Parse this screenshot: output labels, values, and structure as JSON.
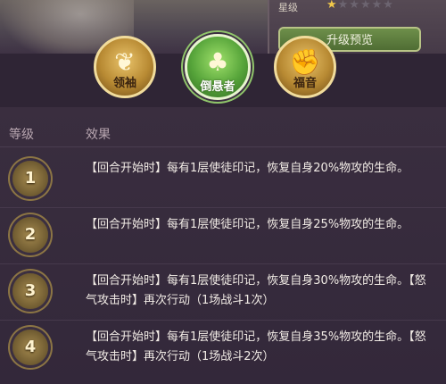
{
  "top": {
    "quality_label": "星级",
    "stars_on": "★",
    "stars_off": "★★★★★",
    "preview_label": "升级预览"
  },
  "tabs": [
    {
      "label": "领袖",
      "icon": "wings-icon",
      "glyph": "❦",
      "active": false
    },
    {
      "label": "倒悬者",
      "icon": "inverted-figure-icon",
      "glyph": "♣",
      "active": true
    },
    {
      "label": "福音",
      "icon": "fist-icon",
      "glyph": "✊",
      "active": false
    }
  ],
  "table": {
    "col_level": "等级",
    "col_effect": "效果",
    "rows": [
      {
        "level": "1",
        "effect": "【回合开始时】每有1层使徒印记，恢复自身20%物攻的生命。"
      },
      {
        "level": "2",
        "effect": "【回合开始时】每有1层使徒印记，恢复自身25%物攻的生命。"
      },
      {
        "level": "3",
        "effect": "【回合开始时】每有1层使徒印记，恢复自身30%物攻的生命。【怒气攻击时】再次行动（1场战斗1次）"
      },
      {
        "level": "4",
        "effect": "【回合开始时】每有1层使徒印记，恢复自身35%物攻的生命。【怒气攻击时】再次行动（1场战斗2次）"
      }
    ]
  },
  "colors": {
    "background": "#3a2d40",
    "active_tab": "#56a43a",
    "gold_tab": "#b88a33",
    "badge": "#8c7544"
  }
}
